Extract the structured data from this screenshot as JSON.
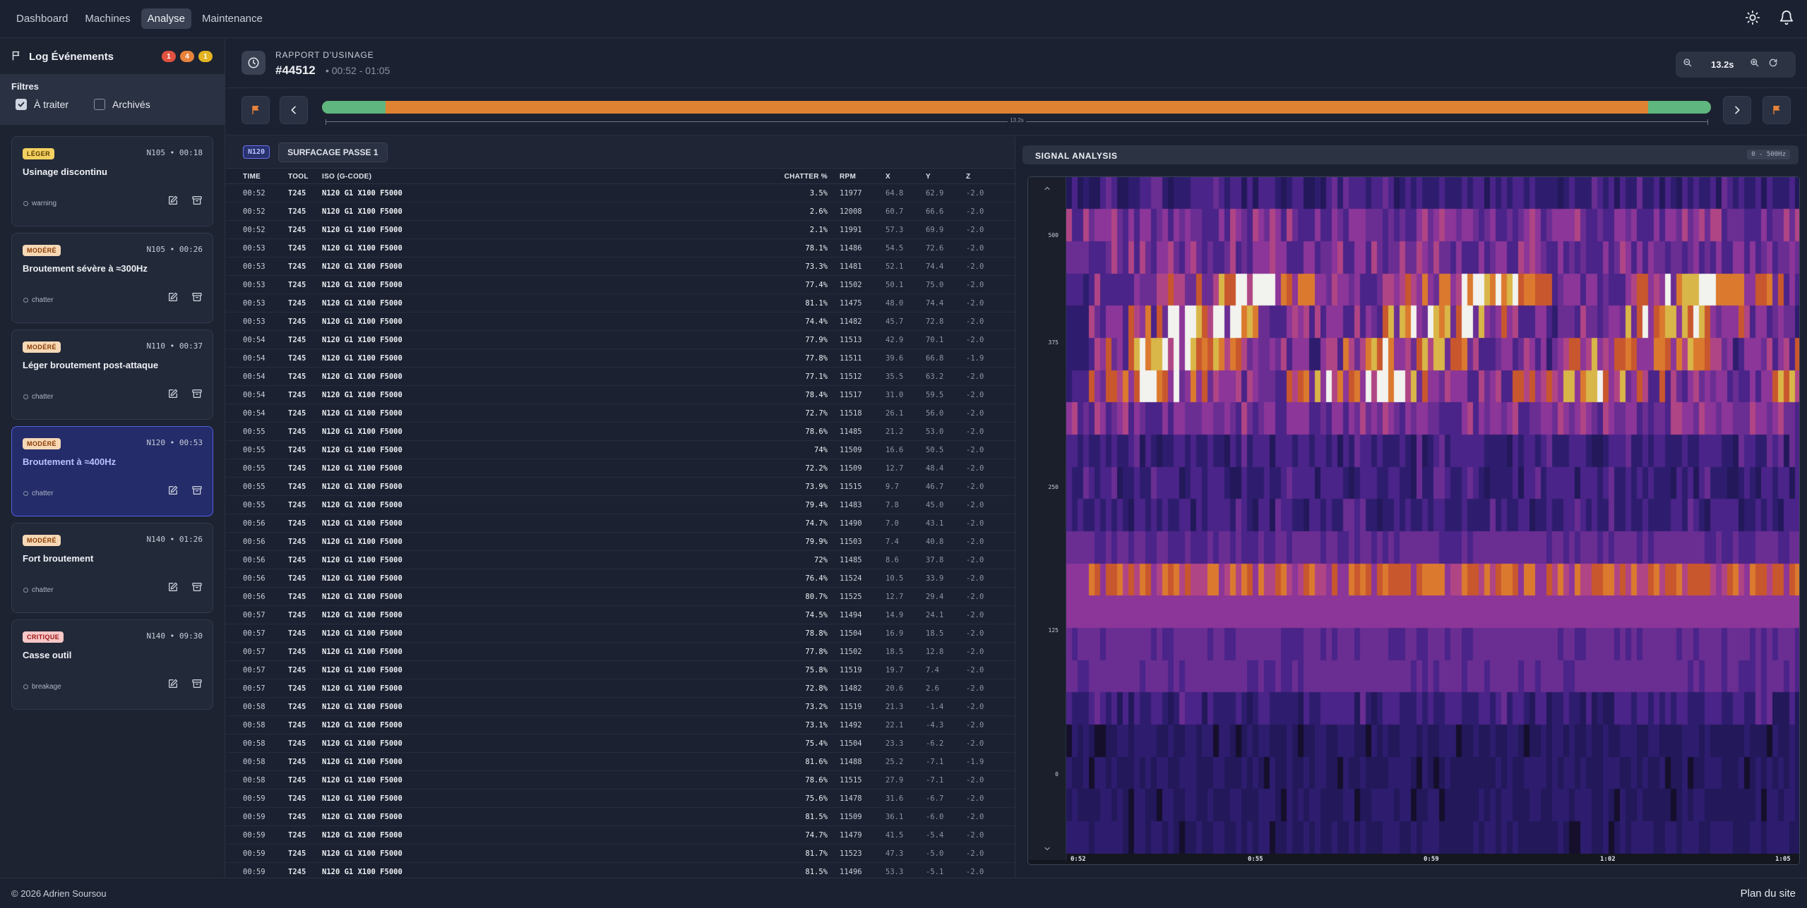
{
  "nav": {
    "items": [
      "Dashboard",
      "Machines",
      "Analyse",
      "Maintenance"
    ],
    "active": "Analyse"
  },
  "sidebar": {
    "title": "Log Événements",
    "badges": [
      {
        "count": "1",
        "color": "#e0523f"
      },
      {
        "count": "4",
        "color": "#e7823b"
      },
      {
        "count": "1",
        "color": "#e3b423"
      }
    ],
    "filters": {
      "title": "Filtres",
      "to_process": "À traiter",
      "archived": "Archivés"
    },
    "events": [
      {
        "severity": "LÉGER",
        "level": "leger",
        "stamp": "N105 • 00:18",
        "title": "Usinage discontinu",
        "tag": "warning"
      },
      {
        "severity": "MODÉRÉ",
        "level": "modere",
        "stamp": "N105 • 00:26",
        "title": "Broutement sévère à ≈300Hz",
        "tag": "chatter"
      },
      {
        "severity": "MODÉRÉ",
        "level": "modere",
        "stamp": "N110 • 00:37",
        "title": "Léger broutement post-attaque",
        "tag": "chatter"
      },
      {
        "severity": "MODÉRÉ",
        "level": "modere",
        "stamp": "N120 • 00:53",
        "title": "Broutement à ≈400Hz",
        "tag": "chatter",
        "selected": true
      },
      {
        "severity": "MODÉRÉ",
        "level": "modere",
        "stamp": "N140 • 01:26",
        "title": "Fort broutement",
        "tag": "chatter"
      },
      {
        "severity": "CRITIQUE",
        "level": "critique",
        "stamp": "N140 • 09:30",
        "title": "Casse outil",
        "tag": "breakage"
      }
    ]
  },
  "report": {
    "title": "RAPPORT D'USINAGE",
    "id": "#44512",
    "range": "• 00:52 - 01:05",
    "zoom": "13.2s"
  },
  "timeline": {
    "duration_label": "13.2s",
    "normal_start_pct": 4.6,
    "normal_end_pct": 95.5
  },
  "table": {
    "chip_n": "N120",
    "chip_op": "SURFACAGE PASSE 1",
    "headers": {
      "time": "TIME",
      "tool": "TOOL",
      "iso": "ISO (G-CODE)",
      "chatter": "CHATTER %",
      "rpm": "RPM",
      "x": "X",
      "y": "Y",
      "z": "Z"
    },
    "rows": [
      [
        "00:52",
        "T245",
        "N120 G1 X100 F5000",
        "3.5%",
        "11977",
        "64.8",
        "62.9",
        "-2.0"
      ],
      [
        "00:52",
        "T245",
        "N120 G1 X100 F5000",
        "2.6%",
        "12008",
        "60.7",
        "66.6",
        "-2.0"
      ],
      [
        "00:52",
        "T245",
        "N120 G1 X100 F5000",
        "2.1%",
        "11991",
        "57.3",
        "69.9",
        "-2.0"
      ],
      [
        "00:53",
        "T245",
        "N120 G1 X100 F5000",
        "78.1%",
        "11486",
        "54.5",
        "72.6",
        "-2.0"
      ],
      [
        "00:53",
        "T245",
        "N120 G1 X100 F5000",
        "73.3%",
        "11481",
        "52.1",
        "74.4",
        "-2.0"
      ],
      [
        "00:53",
        "T245",
        "N120 G1 X100 F5000",
        "77.4%",
        "11502",
        "50.1",
        "75.0",
        "-2.0"
      ],
      [
        "00:53",
        "T245",
        "N120 G1 X100 F5000",
        "81.1%",
        "11475",
        "48.0",
        "74.4",
        "-2.0"
      ],
      [
        "00:53",
        "T245",
        "N120 G1 X100 F5000",
        "74.4%",
        "11482",
        "45.7",
        "72.8",
        "-2.0"
      ],
      [
        "00:54",
        "T245",
        "N120 G1 X100 F5000",
        "77.9%",
        "11513",
        "42.9",
        "70.1",
        "-2.0"
      ],
      [
        "00:54",
        "T245",
        "N120 G1 X100 F5000",
        "77.8%",
        "11511",
        "39.6",
        "66.8",
        "-1.9"
      ],
      [
        "00:54",
        "T245",
        "N120 G1 X100 F5000",
        "77.1%",
        "11512",
        "35.5",
        "63.2",
        "-2.0"
      ],
      [
        "00:54",
        "T245",
        "N120 G1 X100 F5000",
        "78.4%",
        "11517",
        "31.0",
        "59.5",
        "-2.0"
      ],
      [
        "00:54",
        "T245",
        "N120 G1 X100 F5000",
        "72.7%",
        "11518",
        "26.1",
        "56.0",
        "-2.0"
      ],
      [
        "00:55",
        "T245",
        "N120 G1 X100 F5000",
        "78.6%",
        "11485",
        "21.2",
        "53.0",
        "-2.0"
      ],
      [
        "00:55",
        "T245",
        "N120 G1 X100 F5000",
        "74%",
        "11509",
        "16.6",
        "50.5",
        "-2.0"
      ],
      [
        "00:55",
        "T245",
        "N120 G1 X100 F5000",
        "72.2%",
        "11509",
        "12.7",
        "48.4",
        "-2.0"
      ],
      [
        "00:55",
        "T245",
        "N120 G1 X100 F5000",
        "73.9%",
        "11515",
        "9.7",
        "46.7",
        "-2.0"
      ],
      [
        "00:55",
        "T245",
        "N120 G1 X100 F5000",
        "79.4%",
        "11483",
        "7.8",
        "45.0",
        "-2.0"
      ],
      [
        "00:56",
        "T245",
        "N120 G1 X100 F5000",
        "74.7%",
        "11490",
        "7.0",
        "43.1",
        "-2.0"
      ],
      [
        "00:56",
        "T245",
        "N120 G1 X100 F5000",
        "79.9%",
        "11503",
        "7.4",
        "40.8",
        "-2.0"
      ],
      [
        "00:56",
        "T245",
        "N120 G1 X100 F5000",
        "72%",
        "11485",
        "8.6",
        "37.8",
        "-2.0"
      ],
      [
        "00:56",
        "T245",
        "N120 G1 X100 F5000",
        "76.4%",
        "11524",
        "10.5",
        "33.9",
        "-2.0"
      ],
      [
        "00:56",
        "T245",
        "N120 G1 X100 F5000",
        "80.7%",
        "11525",
        "12.7",
        "29.4",
        "-2.0"
      ],
      [
        "00:57",
        "T245",
        "N120 G1 X100 F5000",
        "74.5%",
        "11494",
        "14.9",
        "24.1",
        "-2.0"
      ],
      [
        "00:57",
        "T245",
        "N120 G1 X100 F5000",
        "78.8%",
        "11504",
        "16.9",
        "18.5",
        "-2.0"
      ],
      [
        "00:57",
        "T245",
        "N120 G1 X100 F5000",
        "77.8%",
        "11502",
        "18.5",
        "12.8",
        "-2.0"
      ],
      [
        "00:57",
        "T245",
        "N120 G1 X100 F5000",
        "75.8%",
        "11519",
        "19.7",
        "7.4",
        "-2.0"
      ],
      [
        "00:57",
        "T245",
        "N120 G1 X100 F5000",
        "72.8%",
        "11482",
        "20.6",
        "2.6",
        "-2.0"
      ],
      [
        "00:58",
        "T245",
        "N120 G1 X100 F5000",
        "73.2%",
        "11519",
        "21.3",
        "-1.4",
        "-2.0"
      ],
      [
        "00:58",
        "T245",
        "N120 G1 X100 F5000",
        "73.1%",
        "11492",
        "22.1",
        "-4.3",
        "-2.0"
      ],
      [
        "00:58",
        "T245",
        "N120 G1 X100 F5000",
        "75.4%",
        "11504",
        "23.3",
        "-6.2",
        "-2.0"
      ],
      [
        "00:58",
        "T245",
        "N120 G1 X100 F5000",
        "81.6%",
        "11488",
        "25.2",
        "-7.1",
        "-1.9"
      ],
      [
        "00:58",
        "T245",
        "N120 G1 X100 F5000",
        "78.6%",
        "11515",
        "27.9",
        "-7.1",
        "-2.0"
      ],
      [
        "00:59",
        "T245",
        "N120 G1 X100 F5000",
        "75.6%",
        "11478",
        "31.6",
        "-6.7",
        "-2.0"
      ],
      [
        "00:59",
        "T245",
        "N120 G1 X100 F5000",
        "81.5%",
        "11509",
        "36.1",
        "-6.0",
        "-2.0"
      ],
      [
        "00:59",
        "T245",
        "N120 G1 X100 F5000",
        "74.7%",
        "11479",
        "41.5",
        "-5.4",
        "-2.0"
      ],
      [
        "00:59",
        "T245",
        "N120 G1 X100 F5000",
        "81.7%",
        "11523",
        "47.3",
        "-5.0",
        "-2.0"
      ],
      [
        "00:59",
        "T245",
        "N120 G1 X100 F5000",
        "81.5%",
        "11496",
        "53.3",
        "-5.1",
        "-2.0"
      ]
    ]
  },
  "signal": {
    "title": "SIGNAL ANALYSIS",
    "range": "0 - 500Hz",
    "y_ticks": [
      "500",
      "375",
      "250",
      "125",
      "0"
    ],
    "x_ticks": [
      "0:52",
      "0:55",
      "0:59",
      "1:02",
      "1:05"
    ]
  },
  "footer": {
    "copyright": "© 2026 Adrien Soursou",
    "sitemap": "Plan du site"
  }
}
